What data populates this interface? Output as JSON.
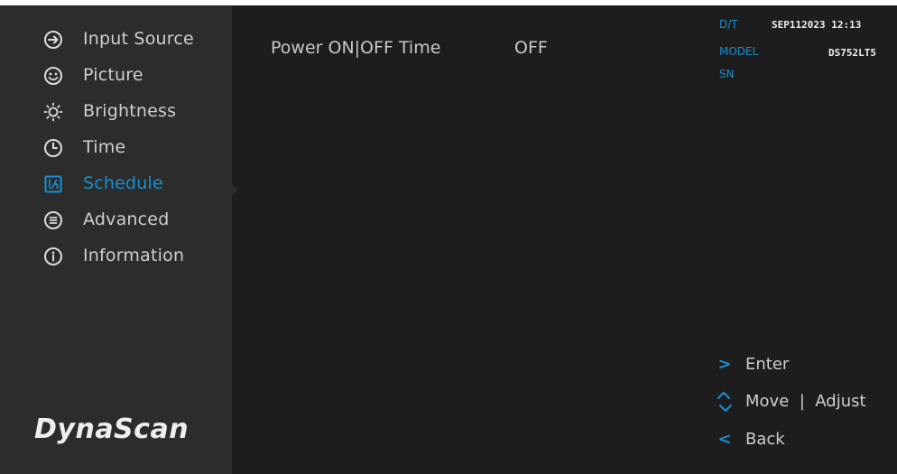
{
  "sidebar": {
    "items": [
      {
        "label": "Input Source",
        "icon": "input-source-icon"
      },
      {
        "label": "Picture",
        "icon": "picture-icon"
      },
      {
        "label": "Brightness",
        "icon": "brightness-icon"
      },
      {
        "label": "Time",
        "icon": "clock-icon"
      },
      {
        "label": "Schedule",
        "icon": "schedule-icon",
        "active": true
      },
      {
        "label": "Advanced",
        "icon": "advanced-icon"
      },
      {
        "label": "Information",
        "icon": "information-icon"
      }
    ],
    "brand": "DynaScan"
  },
  "main": {
    "setting": {
      "label": "Power ON|OFF Time",
      "value": "OFF"
    }
  },
  "info": {
    "dt_label": "D/T",
    "dt_value": "SEP112023 12:13",
    "model_label": "MODEL",
    "model_value": "DS752LT5",
    "sn_label": "SN"
  },
  "hints": {
    "enter": "Enter",
    "move": "Move",
    "separator": "|",
    "adjust": "Adjust",
    "back": "Back"
  },
  "colors": {
    "accent": "#1a8fd0",
    "sidebar_bg": "#2c2c2c",
    "main_bg": "#1d1d1d",
    "text": "#cfcfcf"
  }
}
